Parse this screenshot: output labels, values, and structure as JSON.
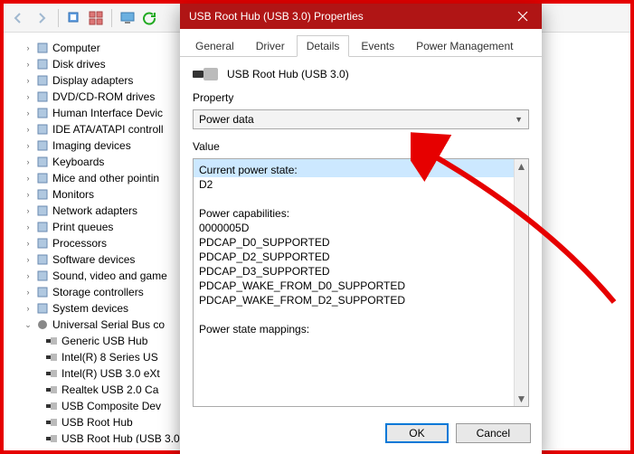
{
  "toolbar": {},
  "tree": {
    "items": [
      {
        "label": "Computer",
        "ico": "pc"
      },
      {
        "label": "Disk drives",
        "ico": "disk"
      },
      {
        "label": "Display adapters",
        "ico": "disp"
      },
      {
        "label": "DVD/CD-ROM drives",
        "ico": "dvd"
      },
      {
        "label": "Human Interface Devic",
        "ico": "hid"
      },
      {
        "label": "IDE ATA/ATAPI controll",
        "ico": "ide"
      },
      {
        "label": "Imaging devices",
        "ico": "img"
      },
      {
        "label": "Keyboards",
        "ico": "kbd"
      },
      {
        "label": "Mice and other pointin",
        "ico": "mouse"
      },
      {
        "label": "Monitors",
        "ico": "mon"
      },
      {
        "label": "Network adapters",
        "ico": "net"
      },
      {
        "label": "Print queues",
        "ico": "print"
      },
      {
        "label": "Processors",
        "ico": "cpu"
      },
      {
        "label": "Software devices",
        "ico": "soft"
      },
      {
        "label": "Sound, video and game",
        "ico": "sound"
      },
      {
        "label": "Storage controllers",
        "ico": "stor"
      },
      {
        "label": "System devices",
        "ico": "sys"
      }
    ],
    "usb_group": "Universal Serial Bus co",
    "usb_children": [
      "Generic USB Hub",
      "Intel(R) 8 Series US",
      "Intel(R) USB 3.0 eXt",
      "Realtek USB 2.0 Ca",
      "USB Composite Dev",
      "USB Root Hub",
      "USB Root Hub (USB 3.0)"
    ]
  },
  "dialog": {
    "title": "USB Root Hub (USB 3.0) Properties",
    "tabs": [
      "General",
      "Driver",
      "Details",
      "Events",
      "Power Management"
    ],
    "active_tab": "Details",
    "device_name": "USB Root Hub (USB 3.0)",
    "property_label": "Property",
    "property_value": "Power data",
    "value_label": "Value",
    "value_lines": [
      "Current power state:",
      "D2",
      "",
      "Power capabilities:",
      "0000005D",
      "PDCAP_D0_SUPPORTED",
      "PDCAP_D2_SUPPORTED",
      "PDCAP_D3_SUPPORTED",
      "PDCAP_WAKE_FROM_D0_SUPPORTED",
      "PDCAP_WAKE_FROM_D2_SUPPORTED",
      "",
      "Power state mappings:"
    ],
    "ok": "OK",
    "cancel": "Cancel"
  }
}
